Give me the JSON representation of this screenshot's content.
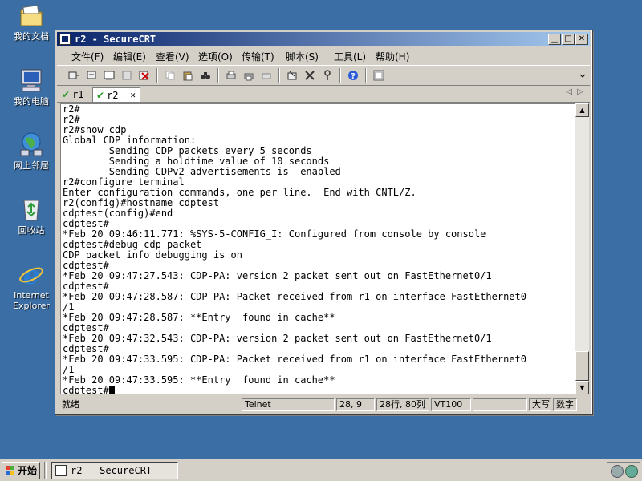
{
  "desktop": {
    "icons": [
      {
        "label": "我的文档",
        "icon": "my-documents-icon"
      },
      {
        "label": "我的电脑",
        "icon": "my-computer-icon"
      },
      {
        "label": "网上邻居",
        "icon": "network-places-icon"
      },
      {
        "label": "回收站",
        "icon": "recycle-bin-icon"
      },
      {
        "label": "Internet Explorer",
        "icon": "internet-explorer-icon"
      }
    ]
  },
  "window": {
    "title": "r2 - SecureCRT",
    "menu": [
      "文件(F)",
      "编辑(E)",
      "查看(V)",
      "选项(O)",
      "传输(T)",
      "脚本(S)",
      "工具(L)",
      "帮助(H)"
    ],
    "tabs": [
      {
        "label": "r1",
        "active": false
      },
      {
        "label": "r2",
        "active": true,
        "close": "✕"
      }
    ],
    "terminal_lines": [
      "r2#",
      "r2#",
      "r2#show cdp",
      "Global CDP information:",
      "        Sending CDP packets every 5 seconds",
      "        Sending a holdtime value of 10 seconds",
      "        Sending CDPv2 advertisements is  enabled",
      "r2#configure terminal",
      "Enter configuration commands, one per line.  End with CNTL/Z.",
      "r2(config)#hostname cdptest",
      "cdptest(config)#end",
      "cdptest#",
      "*Feb 20 09:46:11.771: %SYS-5-CONFIG_I: Configured from console by console",
      "cdptest#debug cdp packet",
      "CDP packet info debugging is on",
      "cdptest#",
      "*Feb 20 09:47:27.543: CDP-PA: version 2 packet sent out on FastEthernet0/1",
      "cdptest#",
      "*Feb 20 09:47:28.587: CDP-PA: Packet received from r1 on interface FastEthernet0",
      "/1",
      "*Feb 20 09:47:28.587: **Entry  found in cache**",
      "cdptest#",
      "*Feb 20 09:47:32.543: CDP-PA: version 2 packet sent out on FastEthernet0/1",
      "cdptest#",
      "*Feb 20 09:47:33.595: CDP-PA: Packet received from r1 on interface FastEthernet0",
      "/1",
      "*Feb 20 09:47:33.595: **Entry  found in cache**"
    ],
    "prompt": "cdptest#",
    "status": {
      "ready": "就绪",
      "protocol": "Telnet",
      "cursor_pos": "28,  9",
      "rows_cols": "28行, 80列",
      "emulation": "VT100",
      "blank": "",
      "caps": "大写",
      "num": "数字"
    }
  },
  "taskbar": {
    "start_label": "开始",
    "task_label": "r2 - SecureCRT"
  },
  "colors": {
    "desktop": "#3a6ea5",
    "titlebar_start": "#0a246a",
    "titlebar_end": "#a6caf0",
    "chrome": "#d4d0c8"
  }
}
